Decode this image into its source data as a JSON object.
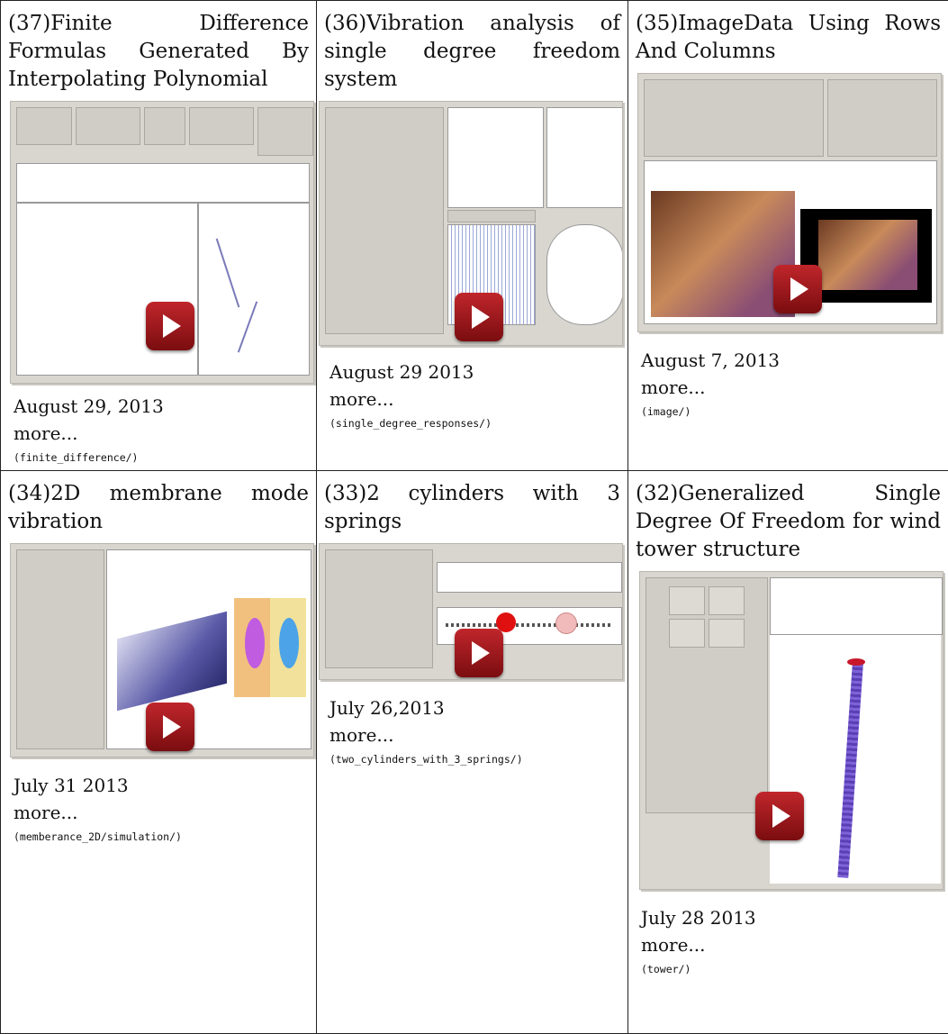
{
  "cells": [
    {
      "title": "(37)Finite Difference Formulas Generated By Interpolating Polynomial",
      "date": "August 29, 2013",
      "more": "more...",
      "path": "(finite_difference/)",
      "icon": "play-button-icon"
    },
    {
      "title": "(36)Vibration analysis of single degree freedom system",
      "date": "August 29 2013",
      "more": "more...",
      "path": "(single_degree_responses/)",
      "icon": "play-button-icon"
    },
    {
      "title": "(35)ImageData Using Rows And Columns",
      "date": "August 7, 2013",
      "more": "more...",
      "path": "(image/)",
      "icon": "play-button-icon"
    },
    {
      "title": "(34)2D membrane mode vibration",
      "date": "July 31 2013",
      "more": "more...",
      "path": "(memberance_2D/simulation/)",
      "icon": "play-button-icon"
    },
    {
      "title": "(33)2 cylinders with 3 springs",
      "date": "July 26,2013",
      "more": "more...",
      "path": "(two_cylinders_with_3_springs/)",
      "icon": "play-button-icon"
    },
    {
      "title": "(32)Generalized Single Degree Of Freedom for wind tower structure",
      "date": "July 28 2013",
      "more": "more...",
      "path": "(tower/)",
      "icon": "play-button-icon"
    }
  ],
  "colors": {
    "play_top": "#c0262b",
    "play_bottom": "#7a0d10",
    "panel": "#d8d6cf"
  }
}
